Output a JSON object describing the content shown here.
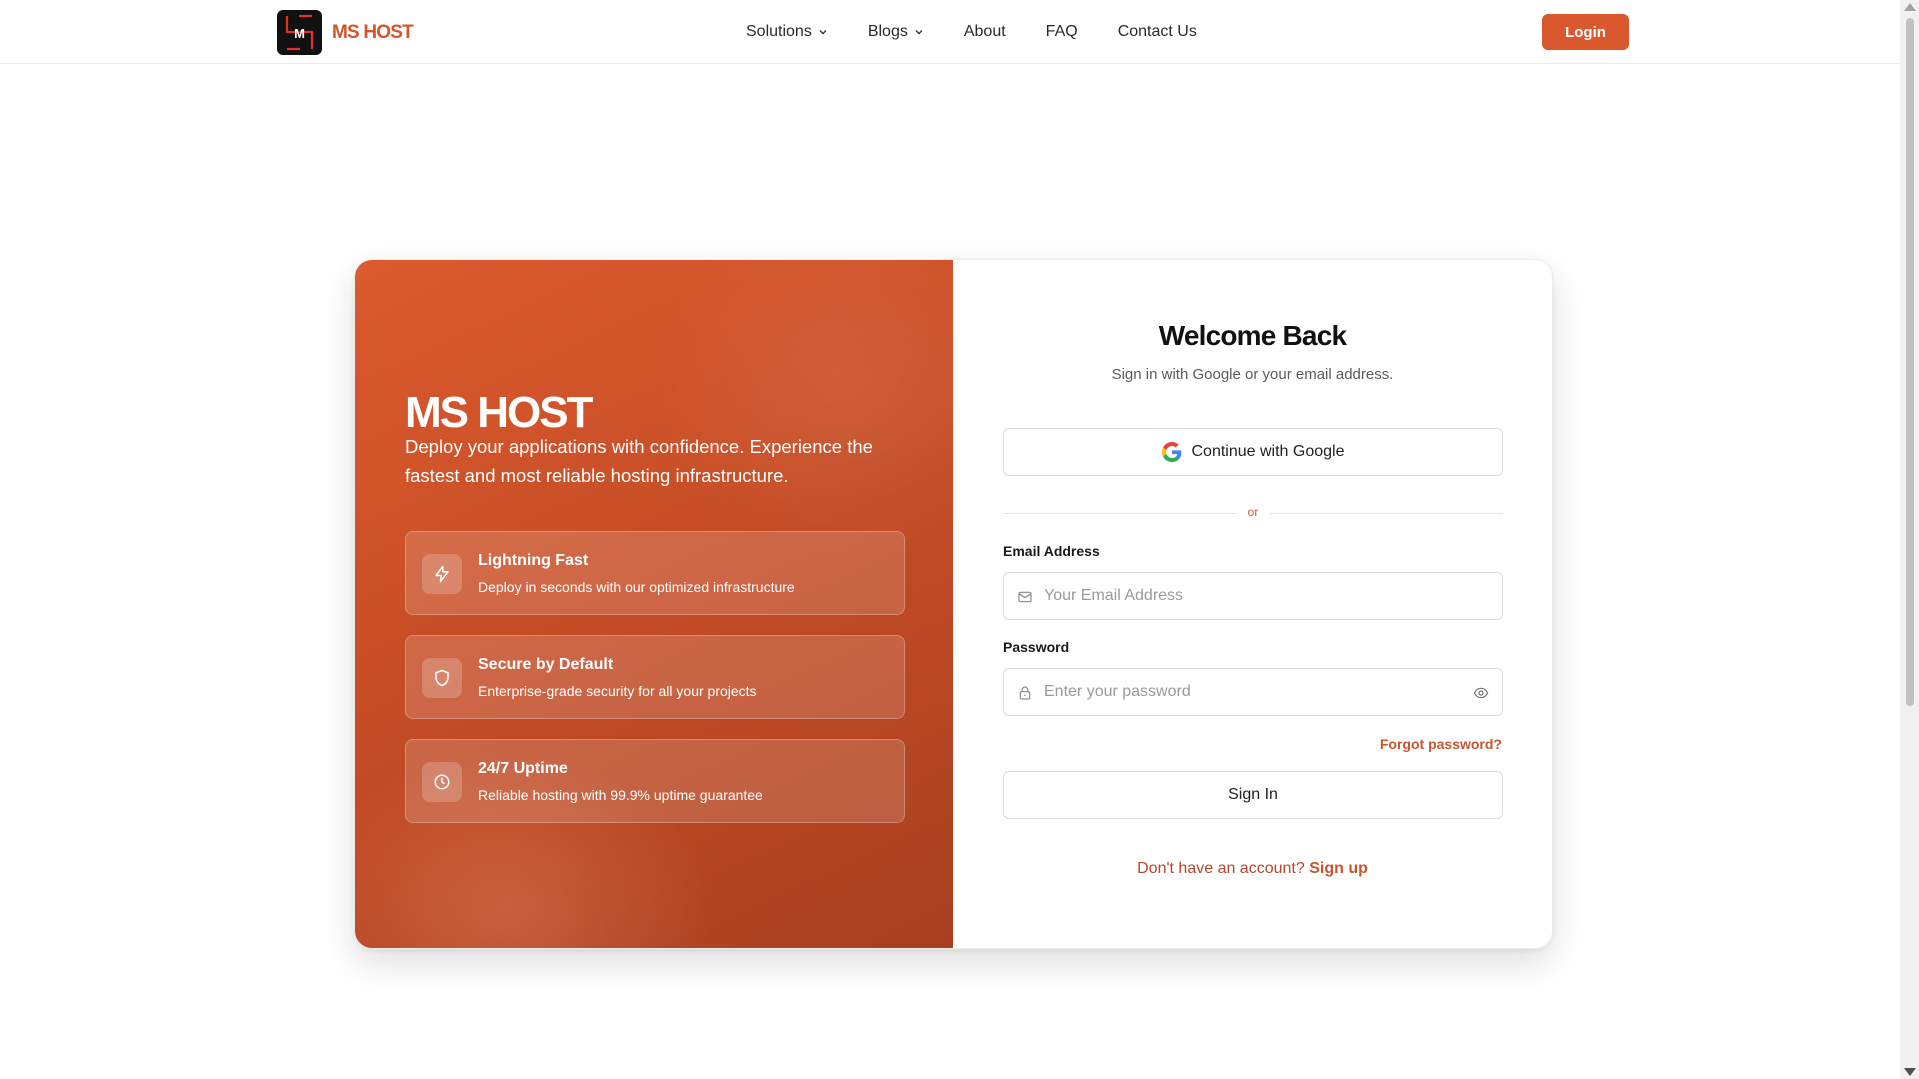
{
  "header": {
    "logo_letter": "M",
    "brand": "MS HOST",
    "nav": [
      {
        "label": "Solutions",
        "has_dropdown": true
      },
      {
        "label": "Blogs",
        "has_dropdown": true
      },
      {
        "label": "About",
        "has_dropdown": false
      },
      {
        "label": "FAQ",
        "has_dropdown": false
      },
      {
        "label": "Contact Us",
        "has_dropdown": false
      }
    ],
    "login_label": "Login"
  },
  "hero": {
    "title": "MS HOST",
    "tagline": "Deploy your applications with confidence. Experience the fastest and most reliable hosting infrastructure.",
    "features": [
      {
        "icon": "lightning-icon",
        "title": "Lightning Fast",
        "description": "Deploy in seconds with our optimized infrastructure"
      },
      {
        "icon": "shield-icon",
        "title": "Secure by Default",
        "description": "Enterprise-grade security for all your projects"
      },
      {
        "icon": "clock-icon",
        "title": "24/7 Uptime",
        "description": "Reliable hosting with 99.9% uptime guarantee"
      }
    ]
  },
  "login_form": {
    "title": "Welcome Back",
    "subtitle": "Sign in with Google or your email address.",
    "google_label": "Continue with Google",
    "divider_text": "or",
    "email_label": "Email Address",
    "email_placeholder": "Your Email Address",
    "email_value": "",
    "password_label": "Password",
    "password_placeholder": "Enter your password",
    "password_value": "",
    "forgot_label": "Forgot password?",
    "signin_label": "Sign In",
    "signup_prompt": "Don't have an account?",
    "signup_link": "Sign up"
  },
  "colors": {
    "accent": "#d9582d",
    "panel_start": "#dc5a2e",
    "panel_end": "#a93f1f",
    "text_dark": "#111111"
  }
}
